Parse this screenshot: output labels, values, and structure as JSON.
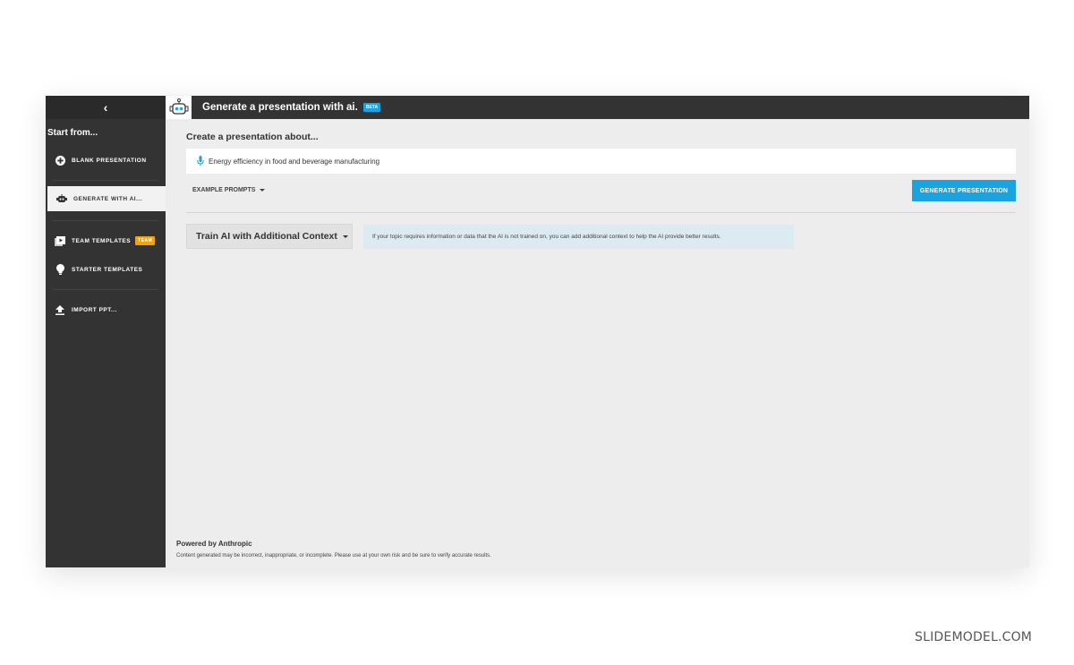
{
  "sidebar": {
    "back_icon": "chevron-left-icon",
    "back_glyph": "‹",
    "heading": "Start from...",
    "items": [
      {
        "label": "BLANK PRESENTATION",
        "icon": "plus-circle-icon",
        "active": false
      },
      {
        "label": "GENERATE WITH AI...",
        "icon": "robot-icon",
        "active": true
      },
      {
        "label": "TEAM TEMPLATES",
        "icon": "play-stack-icon",
        "badge": "TEAM",
        "active": false
      },
      {
        "label": "STARTER TEMPLATES",
        "icon": "lightbulb-icon",
        "active": false
      },
      {
        "label": "IMPORT PPT...",
        "icon": "upload-icon",
        "active": false
      }
    ]
  },
  "header": {
    "icon": "robot-icon",
    "title": "Generate a presentation with ai.",
    "badge": "BETA"
  },
  "main": {
    "create_label": "Create a presentation about...",
    "topic_input": {
      "value": "Energy efficiency in food and beverage manufacturing",
      "icon": "microphone-icon"
    },
    "example_prompts_label": "EXAMPLE PROMPTS",
    "generate_button": "GENERATE PRESENTATION",
    "train_button": "Train AI with Additional Context",
    "info_text": "If your topic requires information or data that the AI is not trained on, you can add additional context to help the AI provide better results.",
    "powered_by": "Powered by Anthropic",
    "disclaimer": "Content generated may be incorrect, inappropriate, or incomplete. Please use at your own risk and be sure to verify accurate results."
  },
  "colors": {
    "accent": "#1aa3e0",
    "team_badge": "#f5a300",
    "sidebar_bg": "#333333",
    "info_bg": "#dceaf1"
  },
  "watermark": "SLIDEMODEL.COM"
}
